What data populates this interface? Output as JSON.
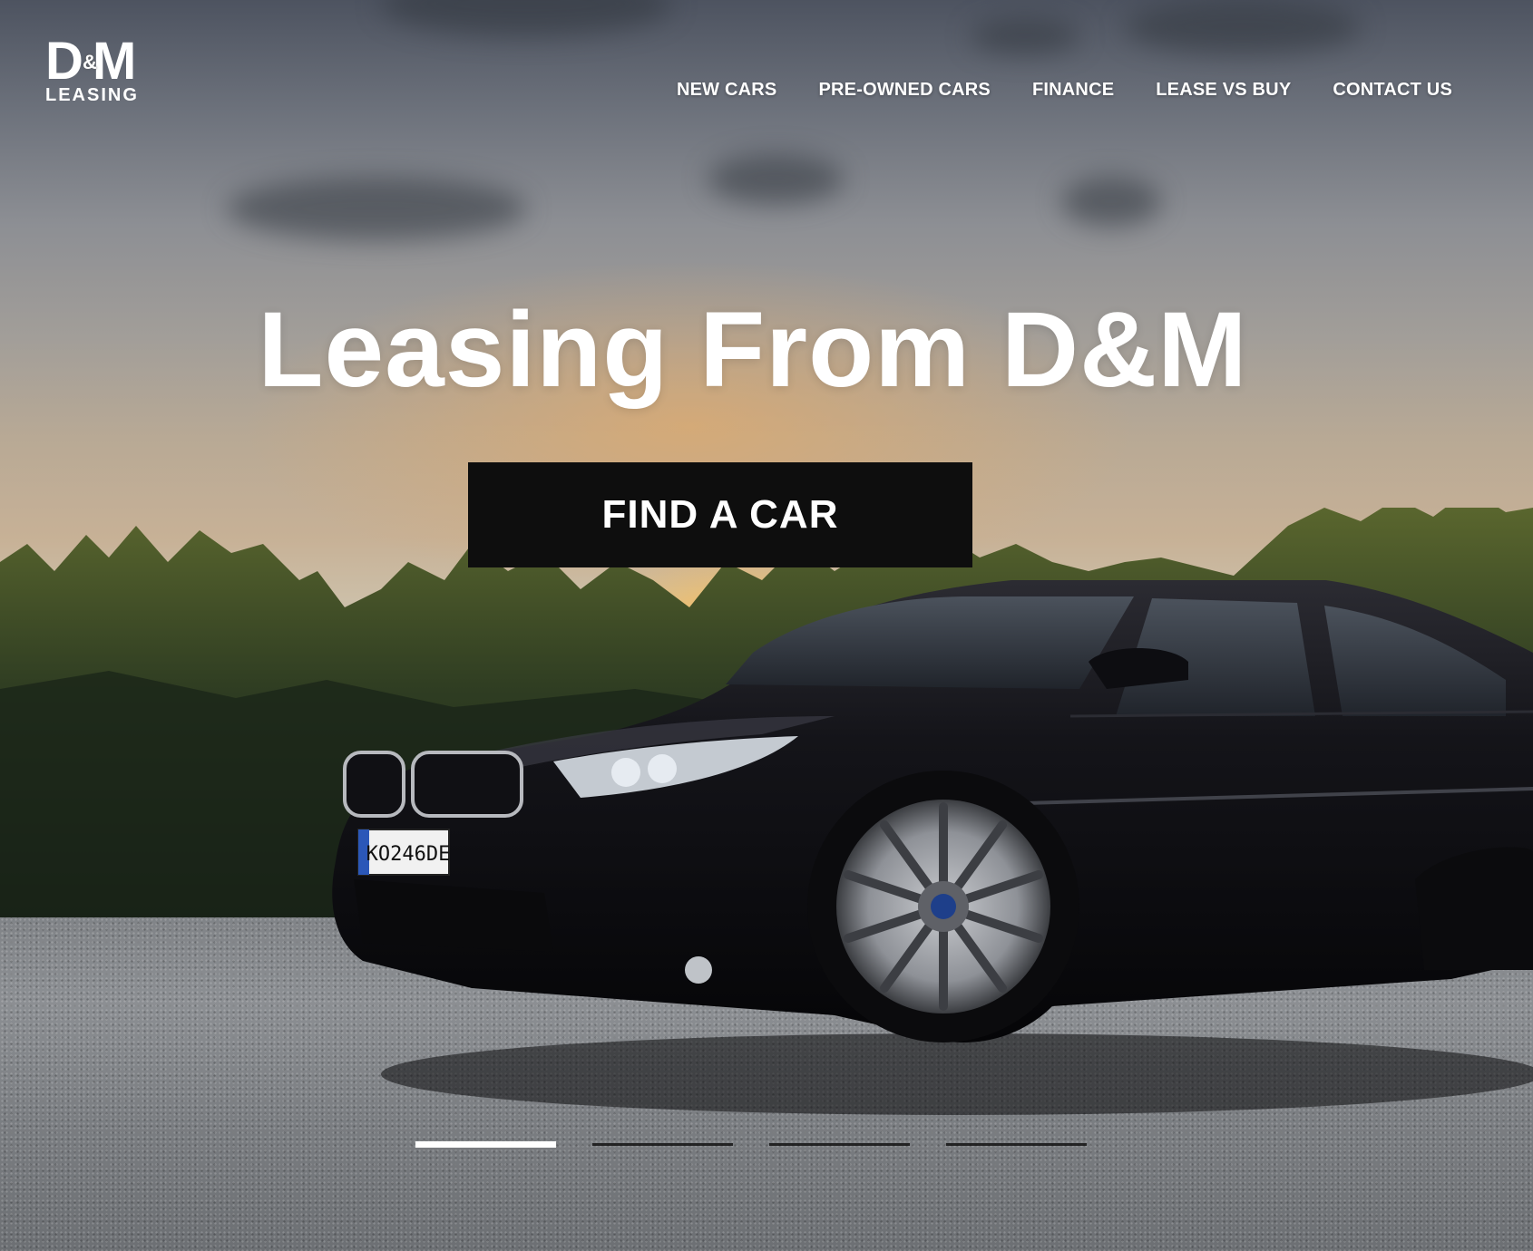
{
  "brand": {
    "logo_mark": "D M",
    "logo_amp": "&",
    "logo_sub": "LEASING"
  },
  "nav": {
    "items": [
      {
        "label": "NEW CARS"
      },
      {
        "label": "PRE-OWNED CARS"
      },
      {
        "label": "FINANCE"
      },
      {
        "label": "LEASE VS BUY"
      },
      {
        "label": "CONTACT US"
      }
    ]
  },
  "hero": {
    "headline": "Leasing From D&M",
    "cta_label": "FIND A CAR",
    "image": "black-bmw-sedan-sunset",
    "license_plate": "KO246DE"
  },
  "carousel": {
    "slide_count": 4,
    "active_index": 0
  },
  "colors": {
    "cta_bg": "#0e0e0e",
    "text": "#ffffff",
    "indicator_active": "#ffffff",
    "indicator_inactive": "#141414"
  }
}
